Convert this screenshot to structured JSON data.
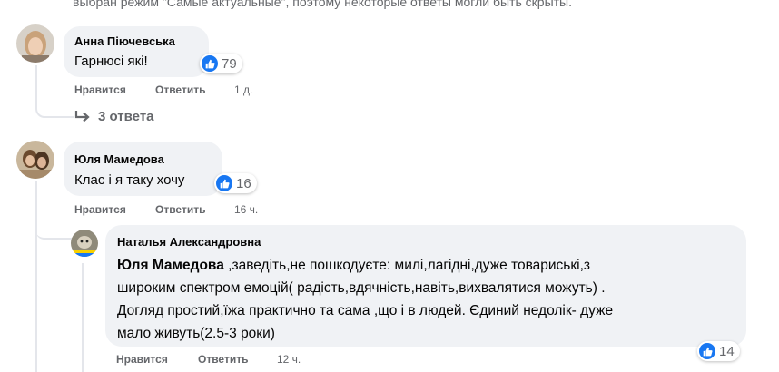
{
  "notice": "выбран режим \"Самые актуальные\", поэтому некоторые ответы могли быть скрыты.",
  "actions": {
    "like": "Нравится",
    "reply": "Ответить"
  },
  "comments": [
    {
      "author": "Анна Піючевська",
      "text": "Гарнюсі які!",
      "likes": "79",
      "time": "1 д.",
      "replies": "3 ответа"
    },
    {
      "author": "Юля Мамедова",
      "text": "Клас і я таку хочу",
      "likes": "16",
      "time": "16 ч."
    }
  ],
  "reply": {
    "author": "Наталья Александровна",
    "mention": "Юля Мамедова",
    "lines": [
      " ,заведіть,не пошкодуєте: милі,лагідні,дуже товариські,з",
      "широким спектром емоцій( радість,вдячність,навіть,вихвалятися можуть) .",
      "Догляд простий,їжа практично та сама ,що і в людей. Єдиний недолік- дуже",
      "мало живуть(2.5-3 роки)"
    ],
    "likes": "14",
    "time": "12 ч."
  },
  "colors": {
    "like_blue": "#1877f2",
    "bubble": "#f0f2f5",
    "muted": "#65676b",
    "thread": "#e4e6eb"
  }
}
